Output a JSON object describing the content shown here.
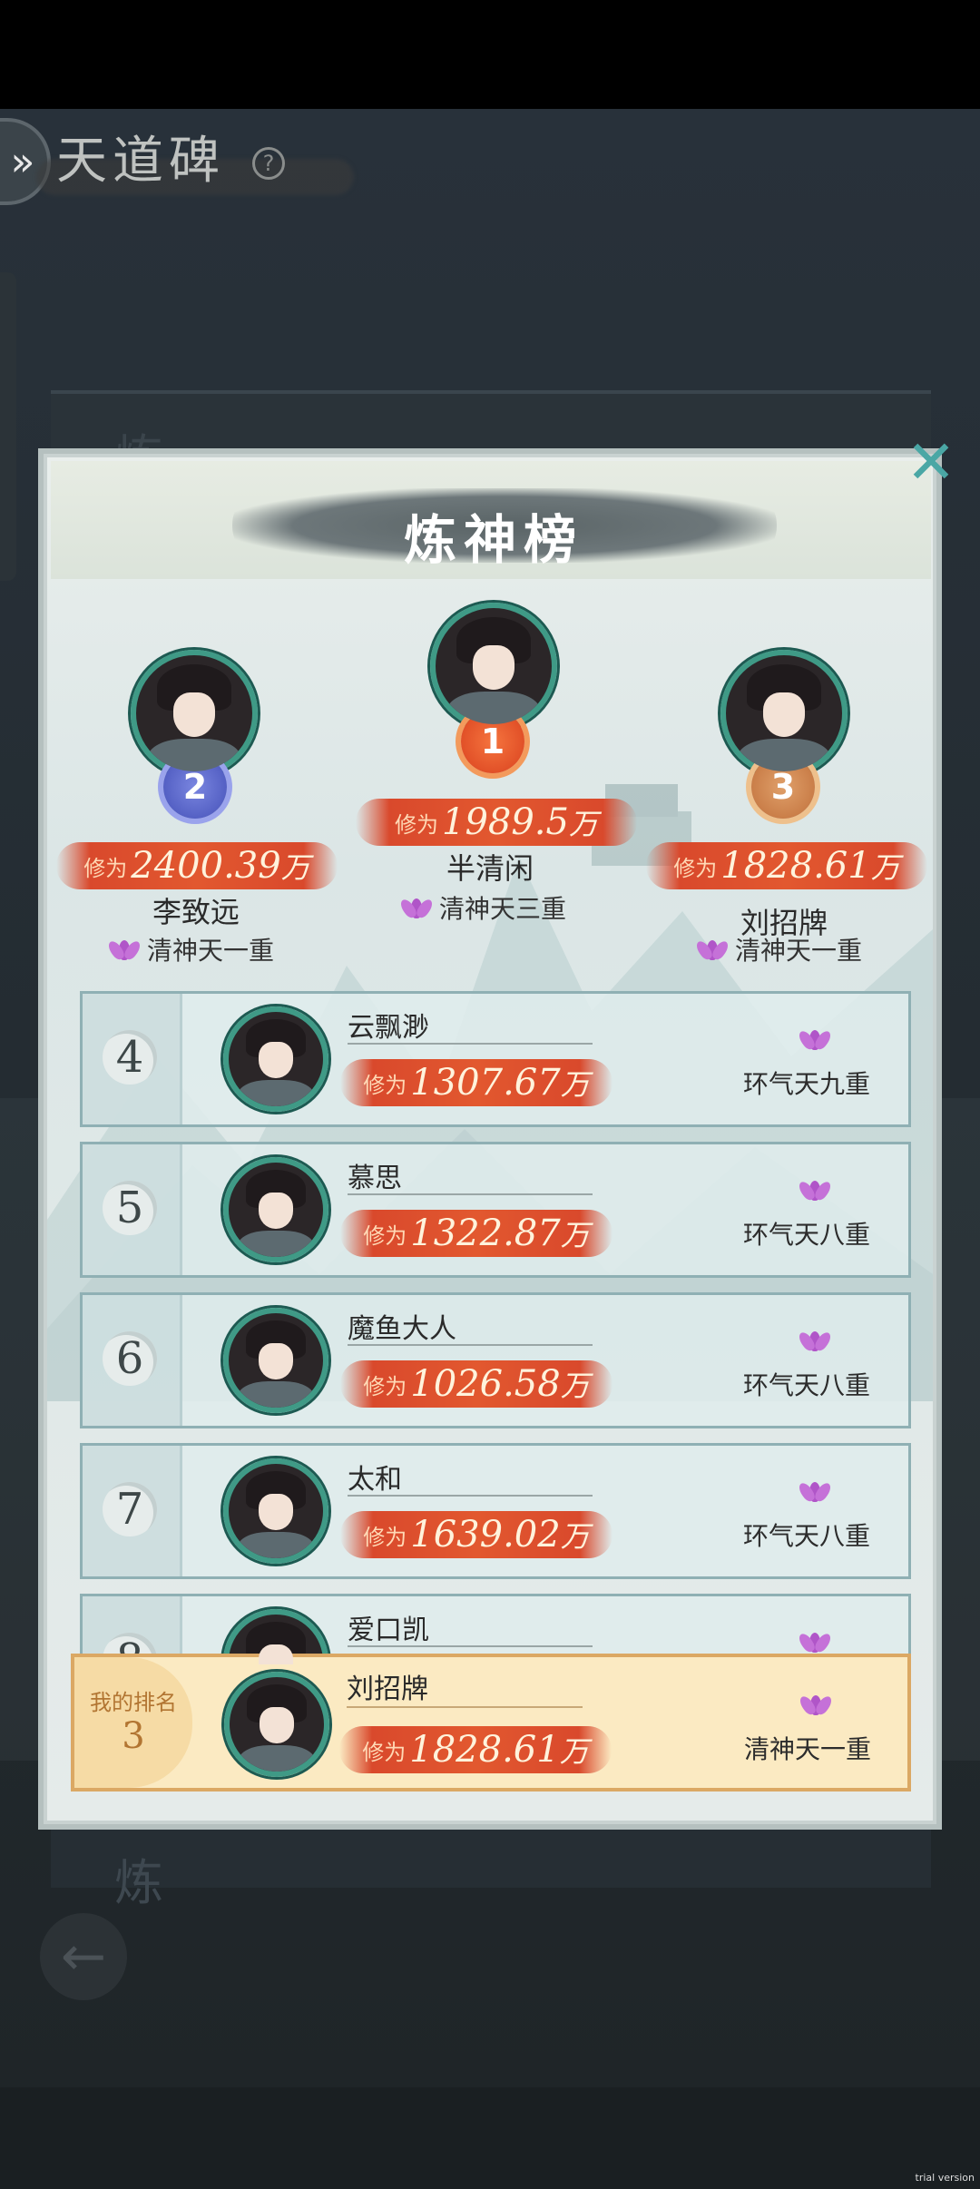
{
  "page": {
    "title": "天道碑",
    "help_symbol": "?"
  },
  "panel": {
    "title": "炼神榜",
    "close_symbol": "✕"
  },
  "background": {
    "ghost_label_top": "炼",
    "ghost_label_bottom": "炼",
    "back_arrow": "←"
  },
  "power_label": "修为",
  "power_unit": "万",
  "podium": [
    {
      "rank": "1",
      "name": "半清闲",
      "power": "1989.5",
      "realm": "清神天三重"
    },
    {
      "rank": "2",
      "name": "李致远",
      "power": "2400.39",
      "realm": "清神天一重"
    },
    {
      "rank": "3",
      "name": "刘招牌",
      "power": "1828.61",
      "realm": "清神天一重"
    }
  ],
  "rows": [
    {
      "rank": "4",
      "name": "云飘渺",
      "power": "1307.67",
      "realm": "环气天九重"
    },
    {
      "rank": "5",
      "name": "慕思",
      "power": "1322.87",
      "realm": "环气天八重"
    },
    {
      "rank": "6",
      "name": "魔鱼大人",
      "power": "1026.58",
      "realm": "环气天八重"
    },
    {
      "rank": "7",
      "name": "太和",
      "power": "1639.02",
      "realm": "环气天八重"
    },
    {
      "rank": "8",
      "name": "爱口凯",
      "power": "",
      "realm": ""
    }
  ],
  "my_rank": {
    "label": "我的排名",
    "rank": "3",
    "name": "刘招牌",
    "power": "1828.61",
    "realm": "清神天一重"
  },
  "colors": {
    "accent_teal": "#3f9a86",
    "ribbon_red": "#d9492c",
    "lotus_purple": "#b055c8",
    "my_row_bg": "#fbeac2"
  },
  "watermark": "trial version"
}
